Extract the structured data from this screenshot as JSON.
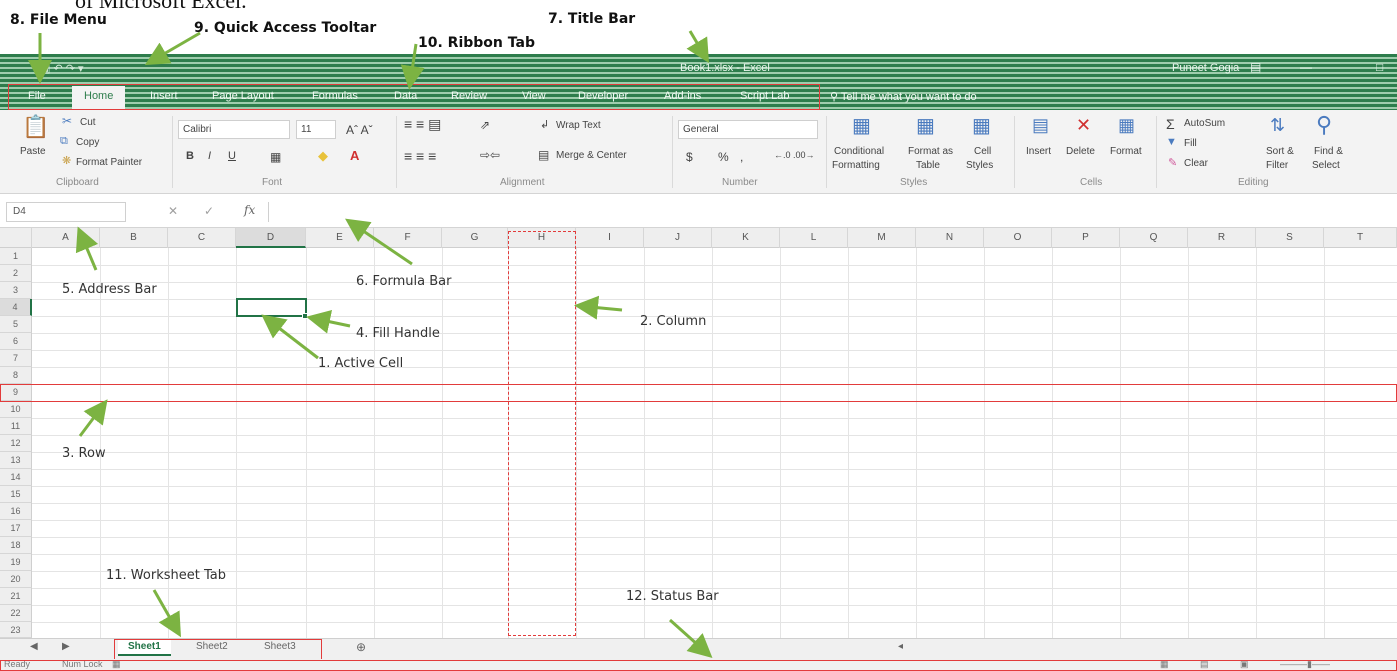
{
  "top": {
    "cut_text": "of Microsoft Excel.",
    "label_file": "8. File Menu",
    "label_qat": "9. Quick Access Tooltar",
    "label_title": "7. Title Bar",
    "label_ribbon": "10. Ribbon Tab"
  },
  "titlebar": {
    "title": "Book1.xlsx - Excel",
    "user": "Puneet Gogia",
    "qat": "▣  ↶  ↷  ▾",
    "min": "—",
    "restore": "□",
    "options": "▤"
  },
  "tabs": [
    "File",
    "Home",
    "Insert",
    "Page Layout",
    "Formulas",
    "Data",
    "Review",
    "View",
    "Developer",
    "Add-ins",
    "Script Lab"
  ],
  "tell_me": "Tell me what you want to do",
  "ribbon": {
    "paste": "Paste",
    "cut": "Cut",
    "copy": "Copy",
    "format_painter": "Format Painter",
    "font_name": "Calibri",
    "font_size": "11",
    "bold": "B",
    "italic": "I",
    "underline": "U",
    "wrap_text": "Wrap Text",
    "merge_center": "Merge & Center",
    "number_format": "General",
    "currency": "$",
    "percent": "%",
    "comma": ",",
    "conditional": "Conditional",
    "formatting": "Formatting",
    "format_as": "Format as",
    "table": "Table",
    "cell": "Cell",
    "styles": "Styles",
    "insert": "Insert",
    "delete": "Delete",
    "format": "Format",
    "autosum": "AutoSum",
    "fill": "Fill",
    "clear": "Clear",
    "sort_filter_1": "Sort &",
    "sort_filter_2": "Filter",
    "find_select_1": "Find &",
    "find_select_2": "Select",
    "groups": [
      "Clipboard",
      "Font",
      "Alignment",
      "Number",
      "Styles",
      "Cells",
      "Editing"
    ]
  },
  "formula_bar": {
    "name_box": "D4",
    "fx": "fx",
    "cancel": "✕",
    "enter": "✓"
  },
  "columns": [
    "A",
    "B",
    "C",
    "D",
    "E",
    "F",
    "G",
    "H",
    "I",
    "J",
    "K",
    "L",
    "M",
    "N",
    "O",
    "P",
    "Q",
    "R",
    "S",
    "T"
  ],
  "rows": [
    "1",
    "2",
    "3",
    "4",
    "5",
    "6",
    "7",
    "8",
    "9",
    "10",
    "11",
    "12",
    "13",
    "14",
    "15",
    "16",
    "17",
    "18",
    "19",
    "20",
    "21",
    "22",
    "23"
  ],
  "annotations": {
    "address_bar": "5. Address Bar",
    "formula_bar": "6. Formula Bar",
    "column": "2. Column",
    "fill_handle": "4. Fill Handle",
    "active_cell": "1. Active Cell",
    "row": "3. Row",
    "worksheet_tab": "11. Worksheet Tab",
    "status_bar": "12. Status Bar"
  },
  "sheets": [
    "Sheet1",
    "Sheet2",
    "Sheet3"
  ],
  "status": {
    "ready": "Ready",
    "num_lock": "Num Lock"
  },
  "colors": {
    "excel_green": "#217346",
    "title_green": "#2e7d4c",
    "annotation_red": "#e23b3b",
    "arrow_green": "#7cb342"
  }
}
